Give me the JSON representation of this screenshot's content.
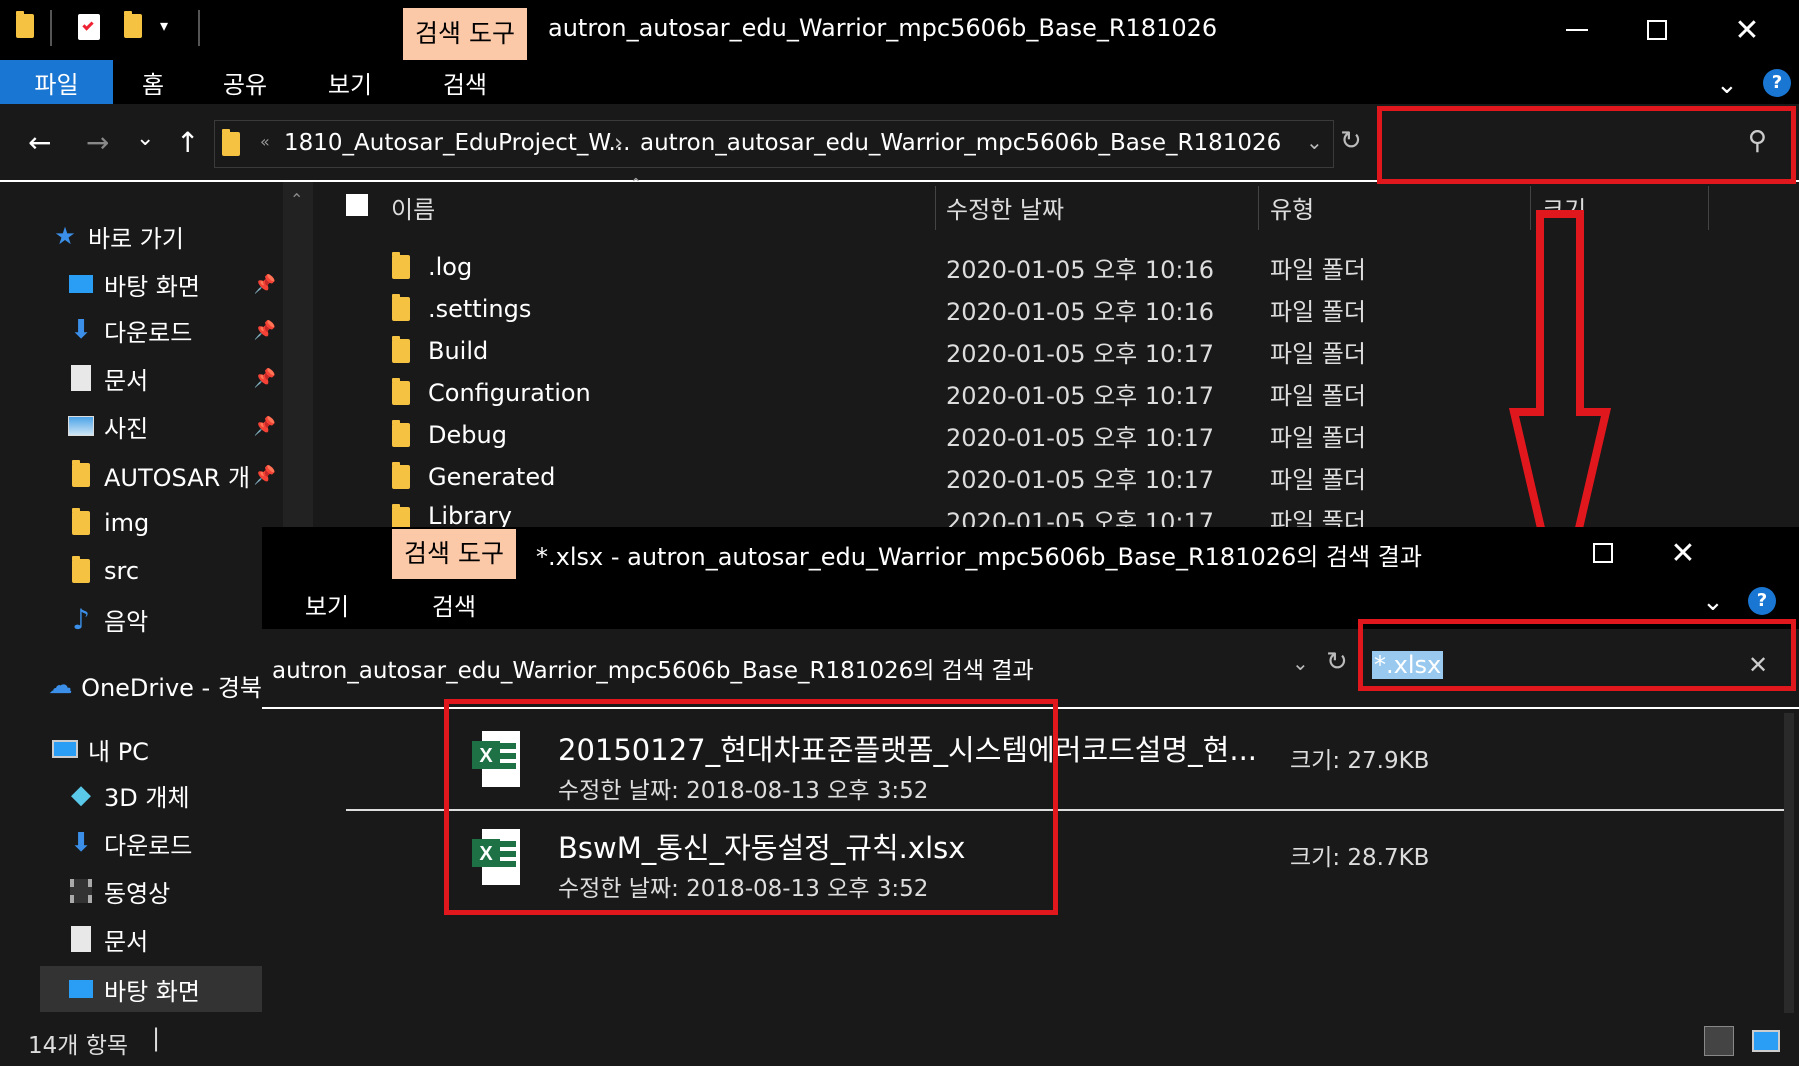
{
  "back_window": {
    "ctx_tab": "검색 도구",
    "title": "autron_autosar_edu_Warrior_mpc5606b_Base_R181026",
    "ribbon_tabs": [
      "파일",
      "홈",
      "공유",
      "보기",
      "검색"
    ],
    "breadcrumb": [
      "1810_Autosar_EduProject_W...",
      "autron_autosar_edu_Warrior_mpc5606b_Base_R181026"
    ],
    "columns": {
      "name": "이름",
      "date": "수정한 날짜",
      "type": "유형",
      "size": "크기"
    },
    "files": [
      {
        "name": ".log",
        "date": "2020-01-05 오후 10:16",
        "type": "파일 폴더"
      },
      {
        "name": ".settings",
        "date": "2020-01-05 오후 10:16",
        "type": "파일 폴더"
      },
      {
        "name": "Build",
        "date": "2020-01-05 오후 10:17",
        "type": "파일 폴더"
      },
      {
        "name": "Configuration",
        "date": "2020-01-05 오후 10:17",
        "type": "파일 폴더"
      },
      {
        "name": "Debug",
        "date": "2020-01-05 오후 10:17",
        "type": "파일 폴더"
      },
      {
        "name": "Generated",
        "date": "2020-01-05 오후 10:17",
        "type": "파일 폴더"
      },
      {
        "name": "Library",
        "date": "2020-01-05 오후 10:17",
        "type": "파일 폴더"
      }
    ],
    "nav": [
      {
        "label": "바로 가기",
        "icon": "star-icon"
      },
      {
        "label": "바탕 화면",
        "icon": "desktop-icon",
        "pinned": true
      },
      {
        "label": "다운로드",
        "icon": "download-icon",
        "pinned": true
      },
      {
        "label": "문서",
        "icon": "document-icon",
        "pinned": true
      },
      {
        "label": "사진",
        "icon": "pictures-icon",
        "pinned": true
      },
      {
        "label": "AUTOSAR 개",
        "icon": "folder-icon",
        "pinned": true
      },
      {
        "label": "img",
        "icon": "folder-icon"
      },
      {
        "label": "src",
        "icon": "folder-icon"
      },
      {
        "label": "음악",
        "icon": "music-icon"
      },
      {
        "label": "OneDrive - 경북",
        "icon": "cloud-icon"
      },
      {
        "label": "내 PC",
        "icon": "pc-icon"
      },
      {
        "label": "3D 개체",
        "icon": "cube-icon"
      },
      {
        "label": "다운로드",
        "icon": "download-icon"
      },
      {
        "label": "동영상",
        "icon": "video-icon"
      },
      {
        "label": "문서",
        "icon": "document-icon"
      },
      {
        "label": "바탕 화면",
        "icon": "desktop-icon"
      }
    ],
    "status": "14개 항목"
  },
  "front_window": {
    "ctx_tab": "검색 도구",
    "title": "*.xlsx - autron_autosar_edu_Warrior_mpc5606b_Base_R181026의 검색 결과",
    "ribbon_tabs": [
      "보기",
      "검색"
    ],
    "address": "autron_autosar_edu_Warrior_mpc5606b_Base_R181026의 검색 결과",
    "search_value": "*.xlsx",
    "results": [
      {
        "name": "20150127_현대차표준플랫폼_시스템에러코드설명_현...",
        "meta": "수정한 날짜: 2018-08-13 오후 3:52",
        "size": "크기: 27.9KB"
      },
      {
        "name": "BswM_통신_자동설정_규칙.xlsx",
        "meta": "수정한 날짜: 2018-08-13 오후 3:52",
        "size": "크기: 28.7KB"
      }
    ]
  },
  "colors": {
    "annotation_red": "#e1171e",
    "file_tab_blue": "#1976d2",
    "ctx_tab_peach": "#fbc8a8",
    "selection_blue": "#99c9ef"
  }
}
